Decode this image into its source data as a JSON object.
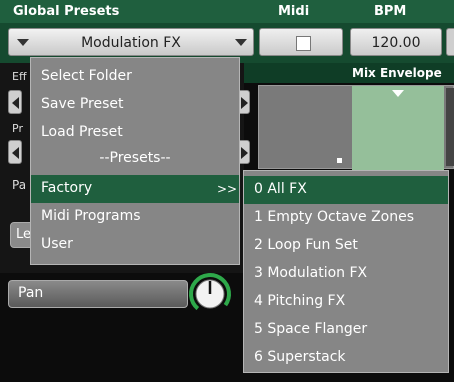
{
  "header": {
    "title": "Global Presets",
    "midi_label": "Midi",
    "bpm_label": "BPM"
  },
  "preset_dropdown": {
    "value": "Modulation FX"
  },
  "midi_toggle": {
    "checked": false
  },
  "bpm_field": {
    "value": "120.00"
  },
  "mix_envelope": {
    "label": "Mix Envelope"
  },
  "left_panel": {
    "label_effect": "Eff",
    "label_preset": "Pr",
    "label_pan_section": "Pa",
    "label_le": "Le"
  },
  "pan": {
    "label": "Pan"
  },
  "menu": {
    "items": [
      "Select Folder",
      "Save Preset",
      "Load Preset"
    ],
    "section_header": "--Presets--",
    "categories": [
      "Factory",
      "Midi Programs",
      "User"
    ],
    "submenu_arrow": ">>",
    "selected_category": "Factory"
  },
  "submenu": {
    "items": [
      "0 All FX",
      "1 Empty Octave Zones",
      "2 Loop Fun Set",
      "3 Modulation FX",
      "4 Pitching FX",
      "5 Space Flanger",
      "6 Superstack"
    ],
    "selected": "0 All FX"
  },
  "colors": {
    "header_green": "#1f5f3e",
    "row_green": "#154a2f",
    "menu_gray": "#868686",
    "envelope_green": "#95bf9a"
  }
}
